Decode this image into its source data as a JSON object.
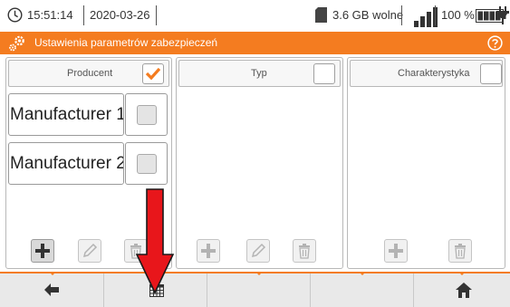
{
  "status_bar": {
    "time": "15:51:14",
    "date": "2020-03-26",
    "storage_free": "3.6 GB wolne",
    "battery_percent": "100 %",
    "signal_level_fraction": 1.0,
    "battery_level_fraction": 1.0
  },
  "title_bar": {
    "title": "Ustawienia parametrów zabezpieczeń",
    "icon": "gears-icon",
    "help_icon": "question-circle-icon"
  },
  "panels": [
    {
      "header": "Producent",
      "header_checked": true,
      "items": [
        {
          "label": "Manufacturer 1",
          "checked": false
        },
        {
          "label": "Manufacturer 2",
          "checked": false
        }
      ],
      "tools": [
        "plus-icon",
        "pencil-icon",
        "trash-icon"
      ]
    },
    {
      "header": "Typ",
      "header_checked": false,
      "items": [],
      "tools": [
        "plus-icon",
        "pencil-icon",
        "trash-icon"
      ]
    },
    {
      "header": "Charakterystyka",
      "header_checked": false,
      "items": [],
      "tools": [
        "plus-icon",
        "trash-icon"
      ]
    }
  ],
  "bottom_nav": {
    "buttons": [
      "back-arrow-icon",
      "table-icon",
      "",
      "",
      "home-icon"
    ]
  },
  "colors": {
    "accent": "#f47c20",
    "annotation_arrow": "#e8161b"
  }
}
